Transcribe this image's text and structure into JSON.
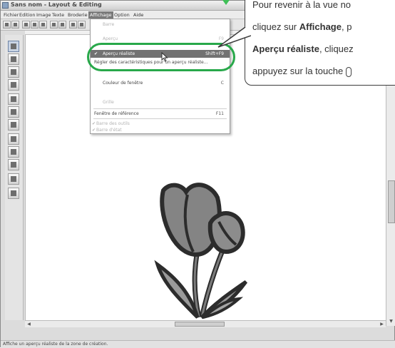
{
  "window": {
    "title": "Sans nom - Layout & Editing"
  },
  "menubar": {
    "items": [
      "Fichier",
      "Edition",
      "Image",
      "Texte",
      "Broderie",
      "Affichage",
      "Option",
      "Aide"
    ],
    "active": "Affichage"
  },
  "dropdown": {
    "items": [
      {
        "label": "Barre",
        "shortcut": "",
        "state": "faded",
        "check": ""
      },
      {
        "label": "Aperçu",
        "shortcut": "F9",
        "state": "faded",
        "check": ""
      },
      {
        "label": "Aperçu réaliste",
        "shortcut": "Shift+F9",
        "state": "highlight",
        "check": "✔"
      },
      {
        "label": "Régler des caractéristiques pour un aperçu réaliste...",
        "shortcut": "",
        "state": "normal",
        "check": ""
      },
      {
        "label": "Couleur de fenêtre",
        "shortcut": "C",
        "state": "normal",
        "check": ""
      },
      {
        "label": "Grille",
        "shortcut": "",
        "state": "faded",
        "check": ""
      },
      {
        "label": "Fenêtre de référence",
        "shortcut": "F11",
        "state": "normal",
        "check": ""
      },
      {
        "label": "Barre des outils",
        "shortcut": "",
        "state": "faded",
        "check": "✔"
      },
      {
        "label": "Barre d'état",
        "shortcut": "",
        "state": "faded",
        "check": "✔"
      }
    ]
  },
  "callout": {
    "line1": "Pour revenir à la vue no",
    "line2_pre": "cliquez sur ",
    "line2_bold": "Affichage",
    "line2_post": ", p",
    "line3_bold": "Aperçu réaliste",
    "line3_post": ", cliquez",
    "line4": "appuyez sur la touche"
  },
  "status": {
    "text": "Affiche un aperçu réaliste de la zone de création."
  },
  "colors": {
    "highlight_ring": "#28a84a",
    "menu_highlight": "#727272"
  }
}
